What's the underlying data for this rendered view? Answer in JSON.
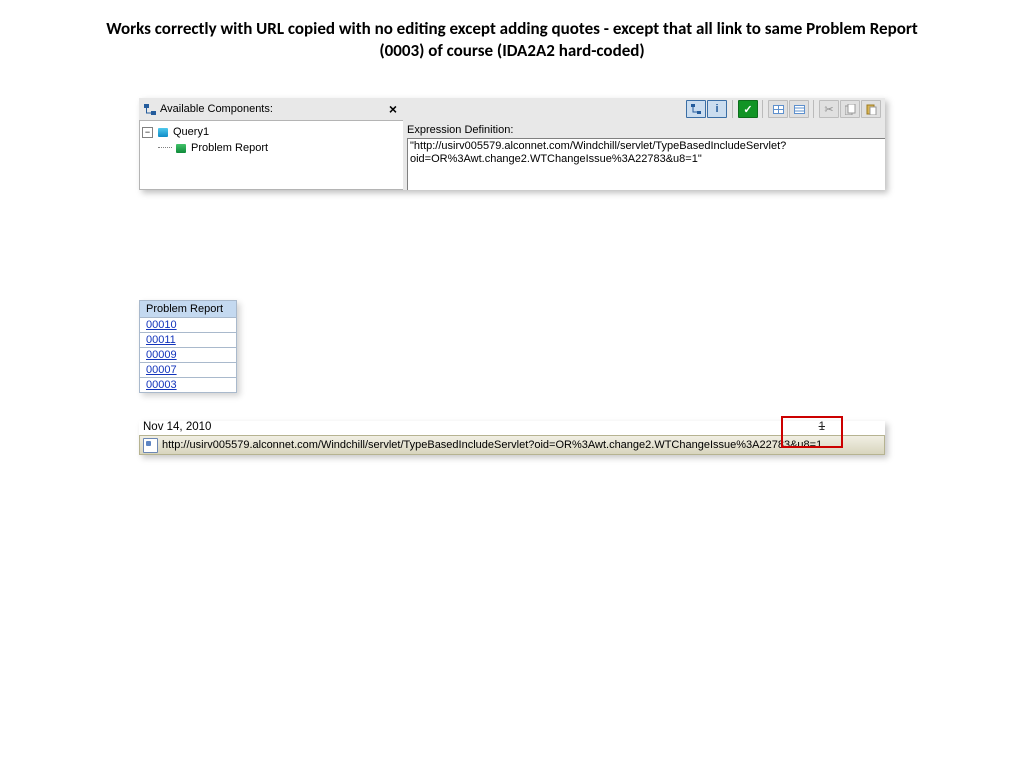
{
  "title": "Works correctly with URL copied with no editing except adding quotes - except that all link to same Problem Report (0003) of course (IDA2A2 hard-coded)",
  "pane": {
    "leftLabel": "Available Components:",
    "tree": {
      "root": "Query1",
      "child": "Problem Report"
    }
  },
  "expr": {
    "label": "Expression Definition:",
    "value": "\"http://usirv005579.alconnet.com/Windchill/servlet/TypeBasedIncludeServlet?oid=OR%3Awt.change2.WTChangeIssue%3A22783&u8=1\""
  },
  "results": {
    "header": "Problem Report",
    "rows": [
      "00010",
      "00011",
      "00009",
      "00007",
      "00003"
    ]
  },
  "status": {
    "date": "Nov 14, 2010",
    "page": "1",
    "url": "http://usirv005579.alconnet.com/Windchill/servlet/TypeBasedIncludeServlet?oid=OR%3Awt.change2.WTChangeIssue%3A22783&u8=1"
  }
}
